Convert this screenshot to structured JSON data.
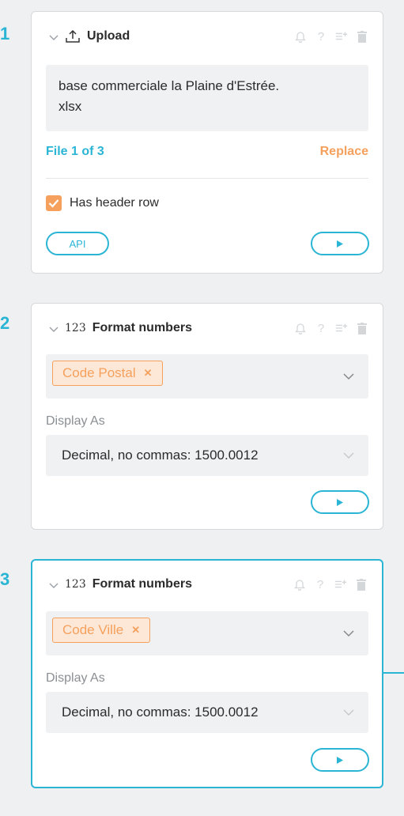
{
  "steps": [
    {
      "number": "1",
      "icon": "upload-icon",
      "title": "Upload",
      "file_name": "base commerciale la Plaine d'Estrée.\nxlsx",
      "file_of": "File 1 of 3",
      "replace_label": "Replace",
      "header_row_label": "Has header row",
      "header_row_checked": true,
      "api_label": "API"
    },
    {
      "number": "2",
      "icon": "numbers-icon",
      "icon_text": "123",
      "title": "Format numbers",
      "selected_column": "Code Postal",
      "display_as_label": "Display As",
      "display_as_value": "Decimal, no commas: 1500.0012"
    },
    {
      "number": "3",
      "icon": "numbers-icon",
      "icon_text": "123",
      "title": "Format numbers",
      "selected_column": "Code Ville",
      "display_as_label": "Display As",
      "display_as_value": "Decimal, no commas: 1500.0012"
    }
  ],
  "colors": {
    "accent": "#2bb5d5",
    "orange": "#f5a05c",
    "tool_grey": "#d4d7da"
  },
  "tool_icons": [
    "bell-icon",
    "help-icon",
    "add-step-icon",
    "delete-icon"
  ]
}
